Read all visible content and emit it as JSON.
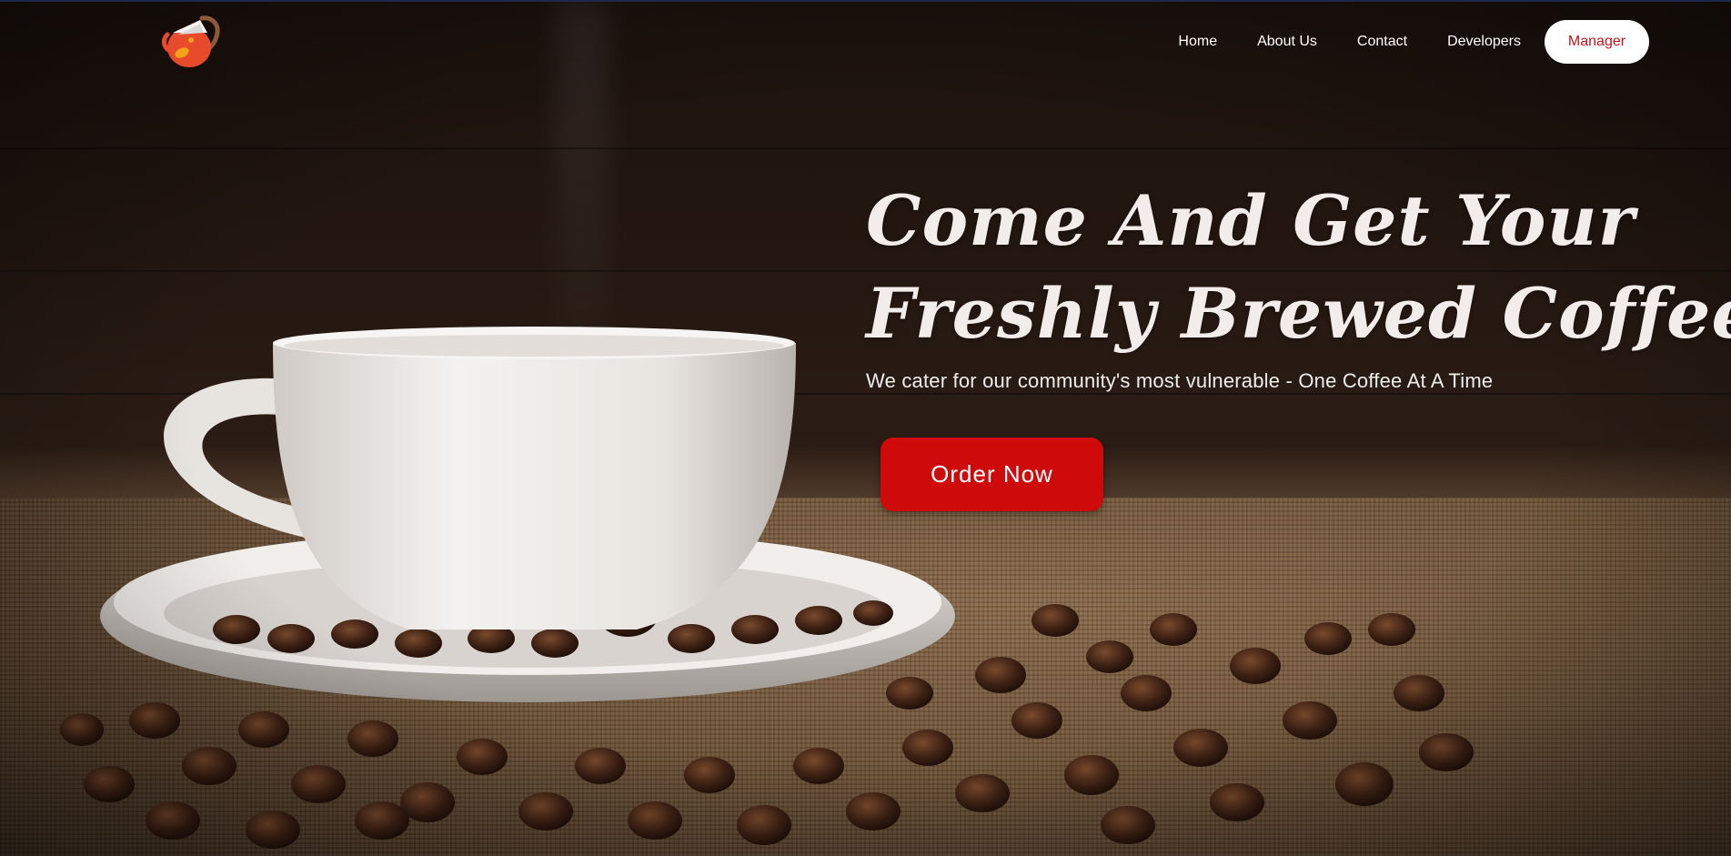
{
  "brand": {
    "logo_icon": "coffee-pot-logo-icon",
    "logo_colors": [
      "#e84a2c",
      "#f5f5f5",
      "#f3a21a",
      "#8a5a3a"
    ]
  },
  "nav": {
    "items": [
      {
        "label": "Home"
      },
      {
        "label": "About Us"
      },
      {
        "label": "Contact"
      },
      {
        "label": "Developers"
      }
    ],
    "manager_label": "Manager"
  },
  "hero": {
    "headline_line1": "Come And Get Your",
    "headline_line2": "Freshly Brewed Coffee",
    "subline": "We cater for our community's most vulnerable - One Coffee At A Time",
    "cta_label": "Order Now",
    "background_image": "coffee-cup-with-beans-on-burlap"
  },
  "colors": {
    "accent": "#cf0a0a",
    "manager_text": "#c0151c",
    "headline": "#f2ecea"
  }
}
